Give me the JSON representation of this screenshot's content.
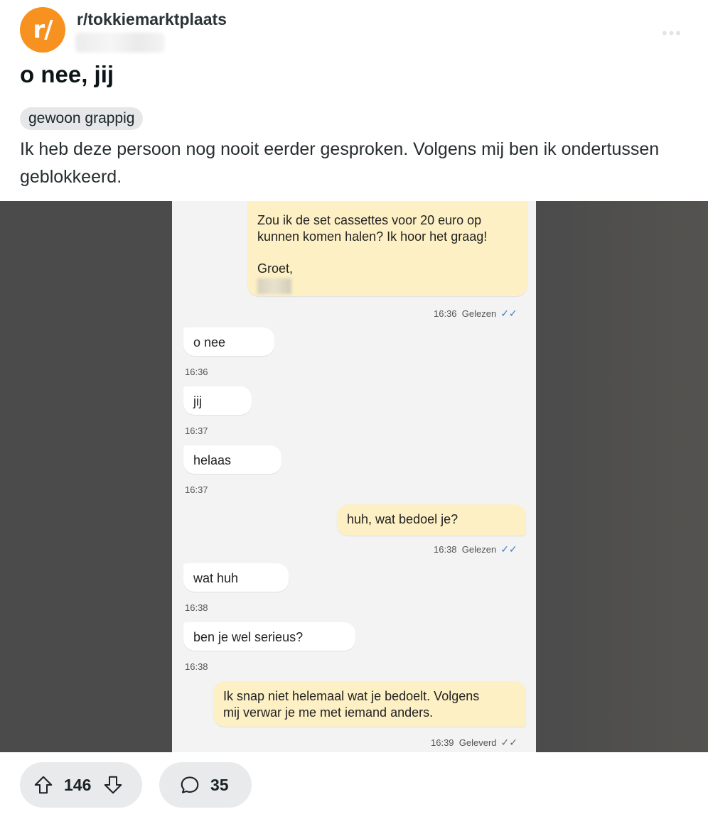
{
  "post": {
    "subreddit": "r/tokkiemarktplaats",
    "avatar_text": "r/",
    "title": "o nee, jij",
    "flair": "gewoon grappig",
    "body": "Ik heb deze persoon nog nooit eerder gesproken. Volgens mij ben ik ondertussen geblokkeerd."
  },
  "chat": {
    "messages": [
      {
        "side": "out",
        "text_lines": [
          "Zou ik de set cassettes voor 20 euro op",
          "kunnen komen halen? Ik hoor het graag!",
          "",
          "Groet,"
        ],
        "time": "16:36",
        "status": "Gelezen"
      },
      {
        "side": "in",
        "text": "o nee",
        "time": "16:36"
      },
      {
        "side": "in",
        "text": "jij",
        "time": "16:37"
      },
      {
        "side": "in",
        "text": "helaas",
        "time": "16:37"
      },
      {
        "side": "out",
        "text": "huh, wat bedoel je?",
        "time": "16:38",
        "status": "Gelezen"
      },
      {
        "side": "in",
        "text": "wat huh",
        "time": "16:38"
      },
      {
        "side": "in",
        "text": "ben je wel serieus?",
        "time": "16:38"
      },
      {
        "side": "out",
        "text_lines": [
          "Ik snap niet helemaal wat je bedoelt. Volgens",
          "mij verwar je me met iemand anders."
        ],
        "time": "16:39",
        "status": "Geleverd"
      }
    ]
  },
  "actions": {
    "upvotes": "146",
    "comments": "35"
  },
  "icons": {
    "upvote": "arrow-up-outline-icon",
    "downvote": "arrow-down-outline-icon",
    "comment": "speech-bubble-icon",
    "read_receipt": "double-check-icon"
  },
  "colors": {
    "subreddit_avatar": "#f7911f",
    "outgoing_bubble": "#fdf0c4",
    "incoming_bubble": "#ffffff",
    "read_tick": "#3b77c8"
  }
}
